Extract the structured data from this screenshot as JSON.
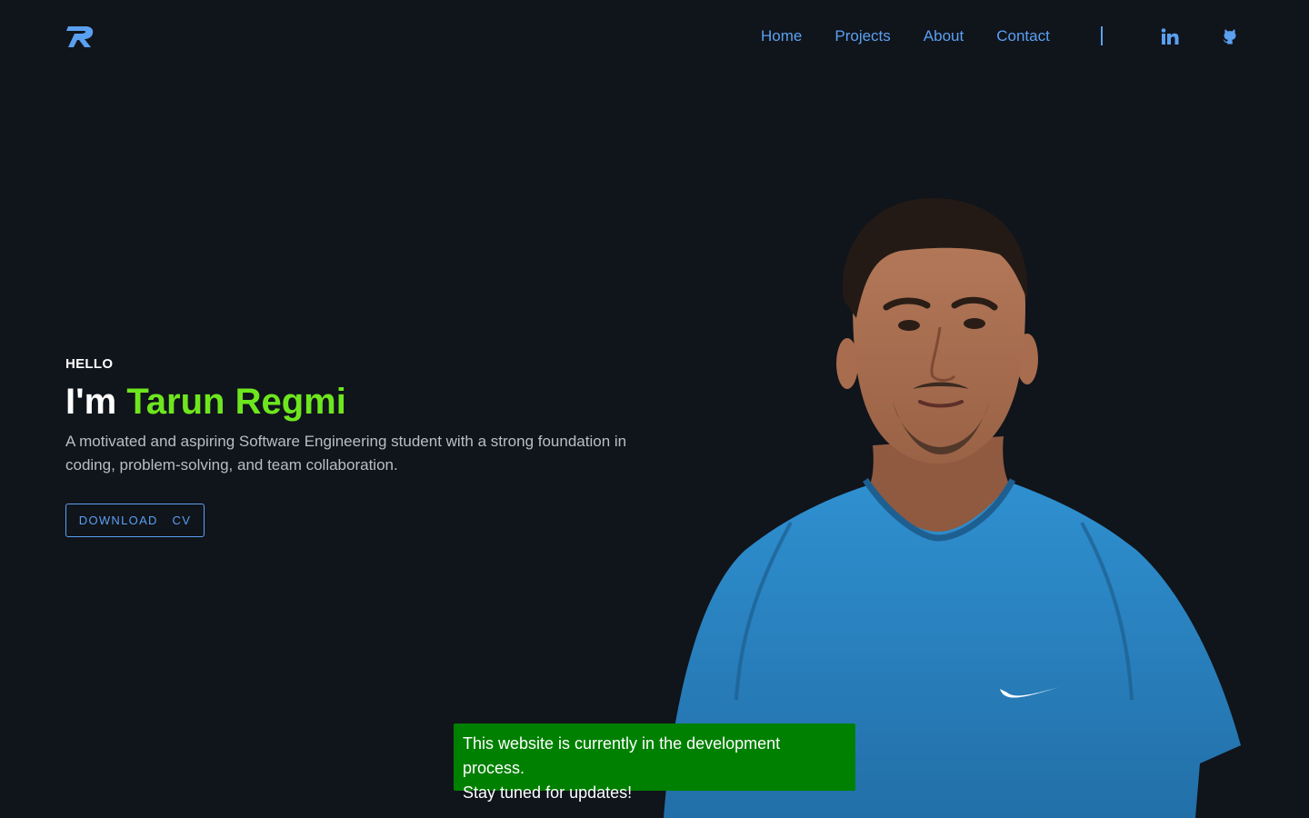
{
  "header": {
    "logo_icon": "r-logo-icon",
    "nav": [
      {
        "label": "Home"
      },
      {
        "label": "Projects"
      },
      {
        "label": "About"
      },
      {
        "label": "Contact"
      }
    ],
    "social": [
      {
        "icon": "linkedin-icon"
      },
      {
        "icon": "github-icon"
      }
    ]
  },
  "hero": {
    "greeting": "HELLO",
    "title_prefix": "I'm",
    "name": "Tarun Regmi",
    "description": "A motivated and aspiring Software Engineering student with a strong foundation in coding, problem-solving, and team collaboration.",
    "cv_button": "DOWNLOAD  CV"
  },
  "toast": {
    "line1": "This website is currently in the development process.",
    "line2": "Stay tuned for updates!"
  },
  "colors": {
    "background": "#10141b",
    "accent": "#5aa0f0",
    "name_highlight": "#6ee61e",
    "toast_bg": "#008000",
    "shirt": "#2b86c6"
  }
}
